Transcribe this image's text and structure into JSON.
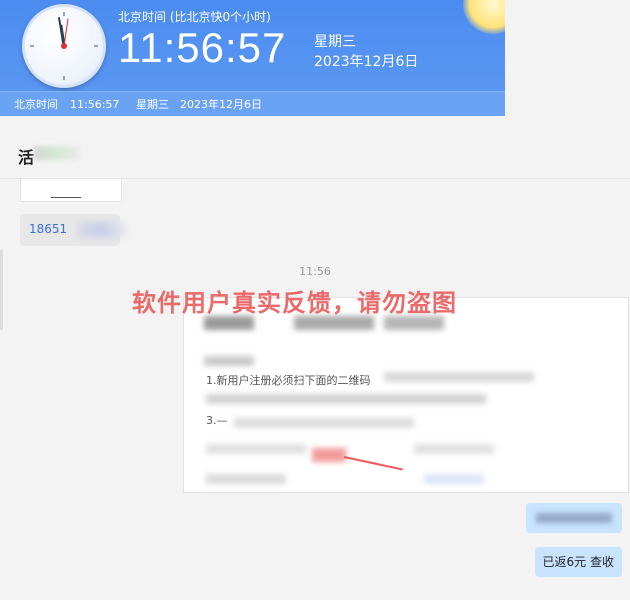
{
  "clock": {
    "timezone_label": "北京时间 (比北京快0个小时)",
    "time": "11:56:57",
    "weekday": "星期三",
    "date": "2023年12月6日",
    "bar_label": "北京时间",
    "bar_time": "11:56:57",
    "bar_weekday": "星期三",
    "bar_date": "2023年12月6日"
  },
  "chat": {
    "title_partial": "活",
    "phone_partial": "18651",
    "message_time": "11:56",
    "watermark": "软件用户真实反馈，请勿盗图",
    "image_text_1": "1.新用户注册必须扫下面的二维码",
    "image_text_2": "3.—",
    "reply_bubble": "已返6元 查收"
  },
  "colors": {
    "clock_blue": "#4f8ff0",
    "bubble_blue": "#c9e4ff",
    "watermark_red": "#e85050"
  }
}
